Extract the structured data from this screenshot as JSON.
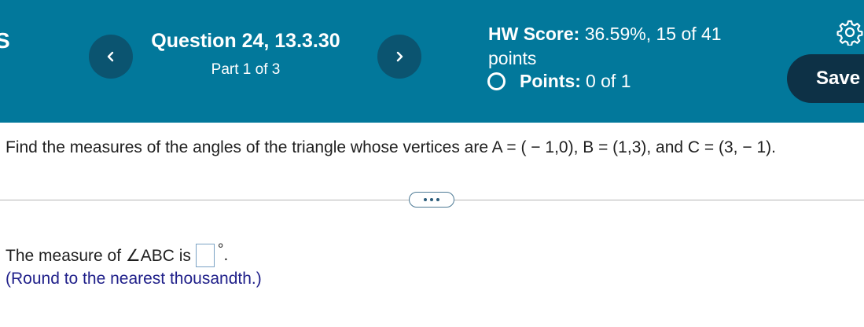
{
  "header": {
    "edge_glyph": "S",
    "question_title": "Question 24, 13.3.30",
    "part_text": "Part 1 of 3",
    "hw_score_label": "HW Score:",
    "hw_score_value": "36.59%, 15 of 41",
    "hw_score_unit": "points",
    "points_label": "Points:",
    "points_value": "0 of 1",
    "save_label": "Save"
  },
  "icons": {
    "prev": "chevron-left-icon",
    "next": "chevron-right-icon",
    "settings": "gear-icon",
    "status": "empty-circle-icon",
    "more": "ellipsis-icon"
  },
  "colors": {
    "header_bg": "#02789b",
    "nav_button_bg": "#0b5470",
    "save_button_bg": "#0d3146",
    "hint_text": "#20208a"
  },
  "body": {
    "question_text": "Find the measures of the angles of the triangle whose vertices are A = ( − 1,0), B = (1,3), and C = (3, − 1).",
    "answer_prefix": "The measure of ∠ABC is",
    "answer_value": "",
    "answer_suffix": ".",
    "degree_symbol": "°",
    "round_note": "(Round to the nearest thousandth.)"
  }
}
